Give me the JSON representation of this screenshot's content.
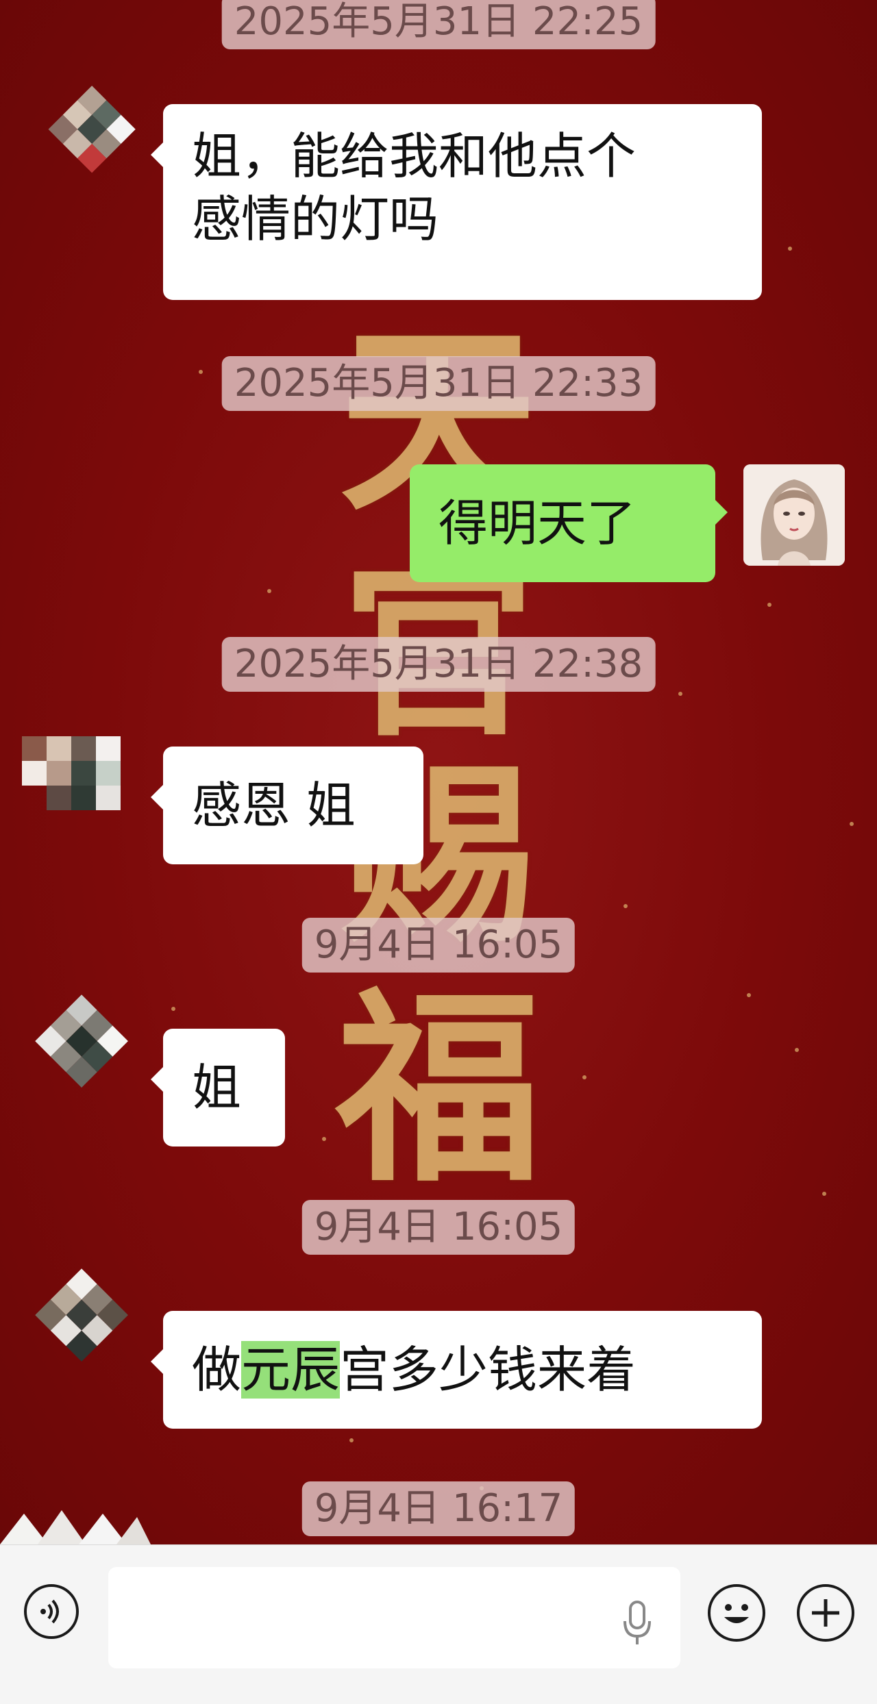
{
  "colors": {
    "chat_background": "#7e0b0b",
    "incoming_bubble": "#ffffff",
    "outgoing_bubble": "#95ec69",
    "highlight": "#95e07a",
    "timestamp_pill": "#e2c8c8",
    "gold_text": "#d9ad6a"
  },
  "background_art": [
    "天",
    "官",
    "赐",
    "福"
  ],
  "messages": [
    {
      "type": "timestamp",
      "text": "2025年5月31日 22:25"
    },
    {
      "type": "incoming",
      "avatar": "mosaic-avatar",
      "lines": [
        "姐，能给我和他点个",
        "感情的灯吗"
      ]
    },
    {
      "type": "timestamp",
      "text": "2025年5月31日 22:33"
    },
    {
      "type": "outgoing",
      "avatar": "illustrated-woman-avatar",
      "text": "得明天了"
    },
    {
      "type": "timestamp",
      "text": "2025年5月31日 22:38"
    },
    {
      "type": "incoming",
      "avatar": "mosaic-avatar",
      "text": "感恩 姐"
    },
    {
      "type": "timestamp",
      "text": "9月4日 16:05"
    },
    {
      "type": "incoming",
      "avatar": "mosaic-avatar",
      "text": "姐"
    },
    {
      "type": "timestamp",
      "text": "9月4日 16:05"
    },
    {
      "type": "incoming",
      "avatar": "mosaic-avatar",
      "text_before": "做",
      "text_highlight": "元辰",
      "text_after": "宫多少钱来着"
    },
    {
      "type": "timestamp",
      "text": "9月4日 16:17"
    }
  ],
  "input_bar": {
    "voice_button_icon": "voice-icon",
    "input_value": "",
    "mic_icon": "microphone-icon",
    "emoji_button_icon": "emoji-icon",
    "plus_button_icon": "plus-icon"
  }
}
